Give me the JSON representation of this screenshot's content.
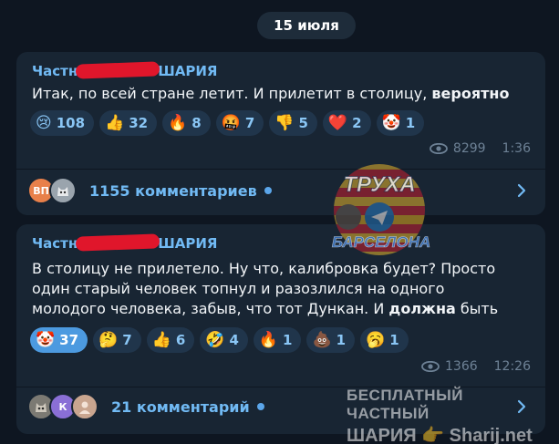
{
  "date_label": "15 июля",
  "posts": [
    {
      "author_start": "Частн",
      "author_end": "ШАРИЯ",
      "text": "Итак, по всей стране летит. И прилетит в столицу,",
      "text_bold": "вероятно",
      "reactions": [
        {
          "icon": "crying-face",
          "emoji": "😢",
          "count": "108"
        },
        {
          "icon": "thumbs-up",
          "emoji": "👍",
          "count": "32"
        },
        {
          "icon": "fire",
          "emoji": "🔥",
          "count": "8"
        },
        {
          "icon": "face-with-symbols-on-mouth",
          "emoji": "🤬",
          "count": "7"
        },
        {
          "icon": "thumbs-down",
          "emoji": "👎",
          "count": "5"
        },
        {
          "icon": "red-heart",
          "emoji": "❤️",
          "count": "2"
        },
        {
          "icon": "clown-face",
          "emoji": "🤡",
          "count": "1"
        }
      ],
      "views": "8299",
      "time": "1:36",
      "comments_label": "1155 комментариев",
      "comment_avatars": [
        {
          "initials": "ВП",
          "color": "#e8804a"
        },
        {
          "initials": "",
          "color": "#9aa4ad"
        }
      ]
    },
    {
      "author_start": "Частн",
      "author_end": "ШАРИЯ",
      "text_lines": [
        "В столицу не прилетело. Ну что, калибровка будет? Просто",
        "один старый человек топнул и разозлился на одного",
        "молодого человека, забыв, что тот Дункан. И"
      ],
      "text_bold": "должна",
      "text_tail": "быть",
      "reactions": [
        {
          "icon": "clown-face",
          "emoji": "🤡",
          "count": "37",
          "active": true
        },
        {
          "icon": "thinking-face",
          "emoji": "🤔",
          "count": "7"
        },
        {
          "icon": "thumbs-up",
          "emoji": "👍",
          "count": "6"
        },
        {
          "icon": "rolling-on-floor-laughing",
          "emoji": "🤣",
          "count": "4"
        },
        {
          "icon": "fire",
          "emoji": "🔥",
          "count": "1"
        },
        {
          "icon": "pile-of-poo",
          "emoji": "💩",
          "count": "1"
        },
        {
          "icon": "yawning-face",
          "emoji": "🥱",
          "count": "1"
        }
      ],
      "views": "1366",
      "time": "12:26",
      "comments_label": "21 комментарий",
      "comment_avatars": [
        {
          "initials": "",
          "color": "#7c7a73"
        },
        {
          "initials": "К",
          "color": "#8a6fd6"
        },
        {
          "initials": "",
          "color": "#c9a58f"
        }
      ]
    }
  ],
  "watermark": {
    "logo_top": "ТРУХА",
    "logo_bottom": "БАРСЕЛОНА",
    "line1": "БЕСПЛАТНЫЙ ЧАСТНЫЙ",
    "line2": "ШАРИЯ 👉 Sharij.net"
  },
  "colors": {
    "background": "#0e1621",
    "bubble": "#182533",
    "accent": "#71baf4",
    "reaction_bg": "#20354b",
    "reaction_active": "#4c9ae0",
    "redaction": "#e0162b"
  }
}
